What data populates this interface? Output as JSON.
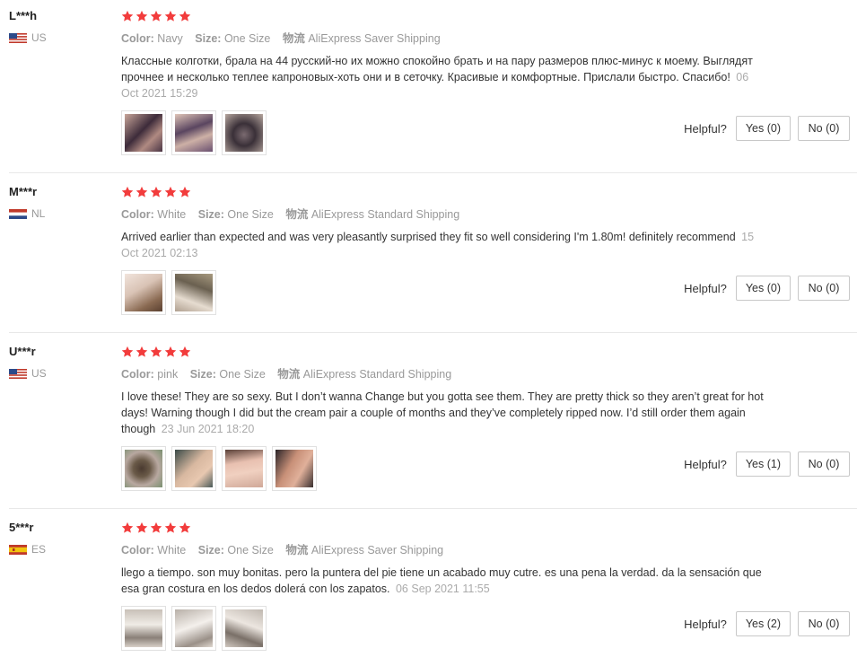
{
  "colors": {
    "star": "#f23c3c",
    "divider": "#e8e8e8",
    "muted": "#999999"
  },
  "labels": {
    "color": "Color:",
    "size": "Size:",
    "shipping": "物流",
    "helpful": "Helpful?"
  },
  "reviews": [
    {
      "user": "L***h",
      "country": "US",
      "stars": 5,
      "color": "Navy",
      "size": "One Size",
      "shipping": "AliExpress Saver Shipping",
      "text": "Классные колготки, брала на 44 русский-но их можно спокойно брать и на пару размеров плюс-минус к моему. Выглядят прочнее и несколько теплее капроновых-хоть они и в сеточку. Красивые и комфортные. Прислали быстро. Спасибо!",
      "date": "06 Oct 2021 15:29",
      "yes": "Yes (0)",
      "no": "No (0)"
    },
    {
      "user": "M***r",
      "country": "NL",
      "stars": 5,
      "color": "White",
      "size": "One Size",
      "shipping": "AliExpress Standard Shipping",
      "text": "Arrived earlier than expected and was very pleasantly surprised they fit so well considering I'm 1.80m! definitely recommend",
      "date": "15 Oct 2021 02:13",
      "yes": "Yes (0)",
      "no": "No (0)"
    },
    {
      "user": "U***r",
      "country": "US",
      "stars": 5,
      "color": "pink",
      "size": "One Size",
      "shipping": "AliExpress Standard Shipping",
      "text": "I love these! They are so sexy. But I don’t wanna Change but you gotta see them. They are pretty thick so they aren’t great for hot days! Warning though I did but the cream pair a couple of months and they’ve completely ripped now. I’d still order them again though",
      "date": "23 Jun 2021 18:20",
      "yes": "Yes (1)",
      "no": "No (0)"
    },
    {
      "user": "5***r",
      "country": "ES",
      "stars": 5,
      "color": "White",
      "size": "One Size",
      "shipping": "AliExpress Saver Shipping",
      "text": "llego a tiempo. son muy bonitas. pero la puntera del pie tiene un acabado muy cutre. es una pena la verdad. da la sensación que esa gran costura en los dedos dolerá con los zapatos.",
      "date": "06 Sep 2021 11:55",
      "yes": "Yes (2)",
      "no": "No (0)"
    }
  ]
}
